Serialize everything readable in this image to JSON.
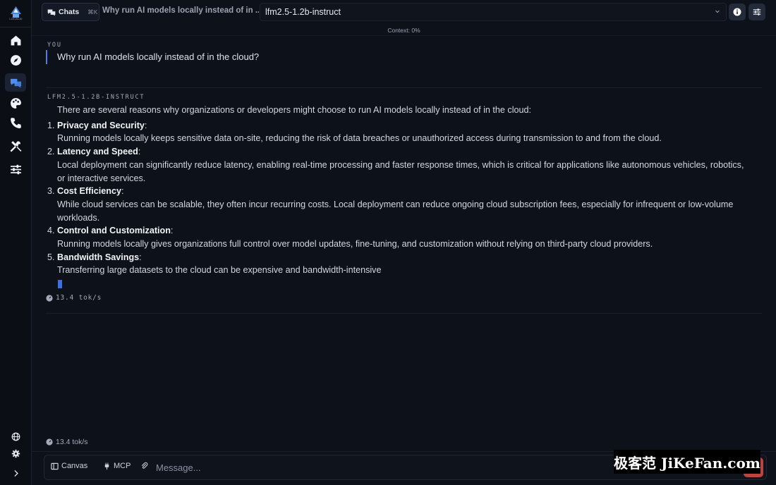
{
  "app": {
    "logo_text": "LOCALAI"
  },
  "sidebar": {
    "items": [
      {
        "name": "home",
        "icon": "home-icon",
        "active": false
      },
      {
        "name": "explore",
        "icon": "compass-icon",
        "active": false
      },
      {
        "name": "chats",
        "icon": "chat-bubbles-icon",
        "active": true
      },
      {
        "name": "themes",
        "icon": "palette-icon",
        "active": false
      },
      {
        "name": "calls",
        "icon": "phone-icon",
        "active": false
      },
      {
        "name": "tools",
        "icon": "tools-icon",
        "active": false
      },
      {
        "name": "settings",
        "icon": "sliders-icon",
        "active": false
      }
    ],
    "bottom": [
      "globe-icon",
      "gear-icon",
      "chevron-right-icon"
    ]
  },
  "header": {
    "chats_label": "Chats",
    "chats_shortcut": "⌘K",
    "chat_title": "Why run AI models locally instead of in ...",
    "model": "lfm2.5-1.2b-instruct",
    "context": "Context: 0%"
  },
  "conversation": {
    "user_role": "YOU",
    "user_message": "Why run AI models locally instead of in the cloud?",
    "assistant_role": "LFM2.5-1.2B-INSTRUCT",
    "intro": "There are several reasons why organizations or developers might choose to run AI models locally instead of in the cloud:",
    "points": [
      {
        "num": "1.",
        "title": "Privacy and Security",
        "body": "Running models locally keeps sensitive data on-site, reducing the risk of data breaches or unauthorized access during transmission to and from the cloud."
      },
      {
        "num": "2.",
        "title": "Latency and Speed",
        "body": "Local deployment can significantly reduce latency, enabling real-time processing and faster response times, which is critical for applications like autonomous vehicles, robotics, or interactive services."
      },
      {
        "num": "3.",
        "title": "Cost Efficiency",
        "body": "While cloud services can be scalable, they often incur recurring costs. Local deployment can reduce ongoing cloud subscription fees, especially for infrequent or low-volume workloads."
      },
      {
        "num": "4.",
        "title": "Control and Customization",
        "body": "Running models locally gives organizations full control over model updates, fine-tuning, and customization without relying on third-party cloud providers."
      },
      {
        "num": "5.",
        "title": "Bandwidth Savings",
        "body": "Transferring large datasets to the cloud can be expensive and bandwidth-intensive"
      }
    ],
    "message_speed": "13.4 tok/s",
    "footer_speed": "13.4 tok/s"
  },
  "composer": {
    "canvas_label": "Canvas",
    "mcp_label": "MCP",
    "placeholder": "Message..."
  },
  "watermark": "极客范 JiKeFan.com",
  "colors": {
    "accent": "#4f7fe6",
    "send_button": "#b8453f",
    "background": "#0d1119"
  }
}
